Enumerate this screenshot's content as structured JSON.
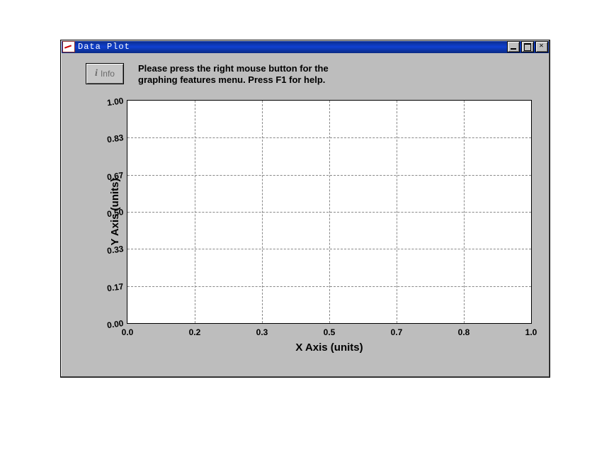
{
  "window": {
    "title": "Data Plot"
  },
  "info_button": {
    "label": "Info"
  },
  "instructions": {
    "line1": "Please press the right mouse button for the",
    "line2": "graphing features menu.  Press F1 for help."
  },
  "chart_data": {
    "type": "line",
    "series": [],
    "x_ticks": [
      "0.0",
      "0.2",
      "0.3",
      "0.5",
      "0.7",
      "0.8",
      "1.0"
    ],
    "y_ticks": [
      "0.00",
      "0.17",
      "0.33",
      "0.50",
      "0.67",
      "0.83",
      "1.00"
    ],
    "xlabel": "X Axis (units)",
    "ylabel": "Y Axis (units)",
    "xlim": [
      0.0,
      1.0
    ],
    "ylim": [
      0.0,
      1.0
    ],
    "grid": true
  }
}
